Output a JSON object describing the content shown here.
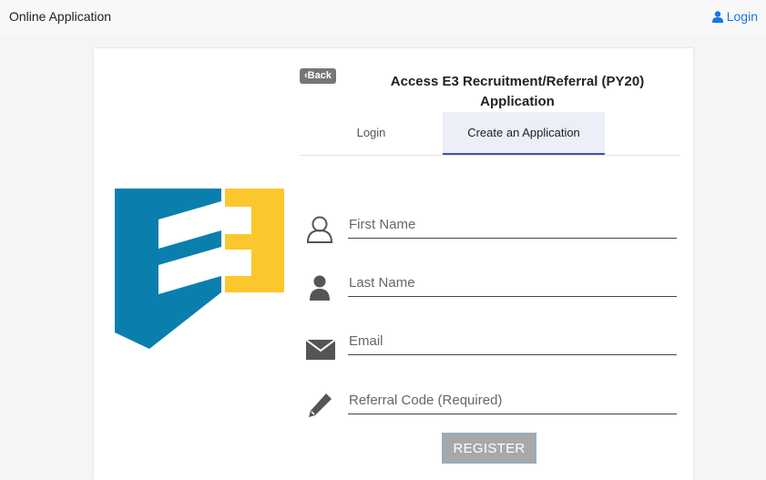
{
  "header": {
    "app_title": "Online Application",
    "login_label": "Login",
    "login_icon": "user-icon",
    "link_color": "#1a73e8"
  },
  "form": {
    "back_label": "‹Back",
    "title_line1": "Access E3 Recruitment/Referral (PY20)",
    "title_line2": "Application",
    "tabs": [
      {
        "label": "Login",
        "active": false
      },
      {
        "label": "Create an Application",
        "active": true
      }
    ],
    "fields": {
      "first_name": {
        "placeholder": "First Name",
        "value": "",
        "icon": "user-outline-icon"
      },
      "last_name": {
        "placeholder": "Last Name",
        "value": "",
        "icon": "user-solid-icon"
      },
      "email": {
        "placeholder": "Email",
        "value": "",
        "icon": "envelope-icon"
      },
      "referral_code": {
        "placeholder": "Referral Code (Required)",
        "value": "",
        "icon": "pencil-icon"
      }
    },
    "register_label": "REGISTER"
  },
  "logo": {
    "name": "e3-logo",
    "colors": {
      "blue": "#0a7fad",
      "yellow": "#fcc72c"
    }
  }
}
